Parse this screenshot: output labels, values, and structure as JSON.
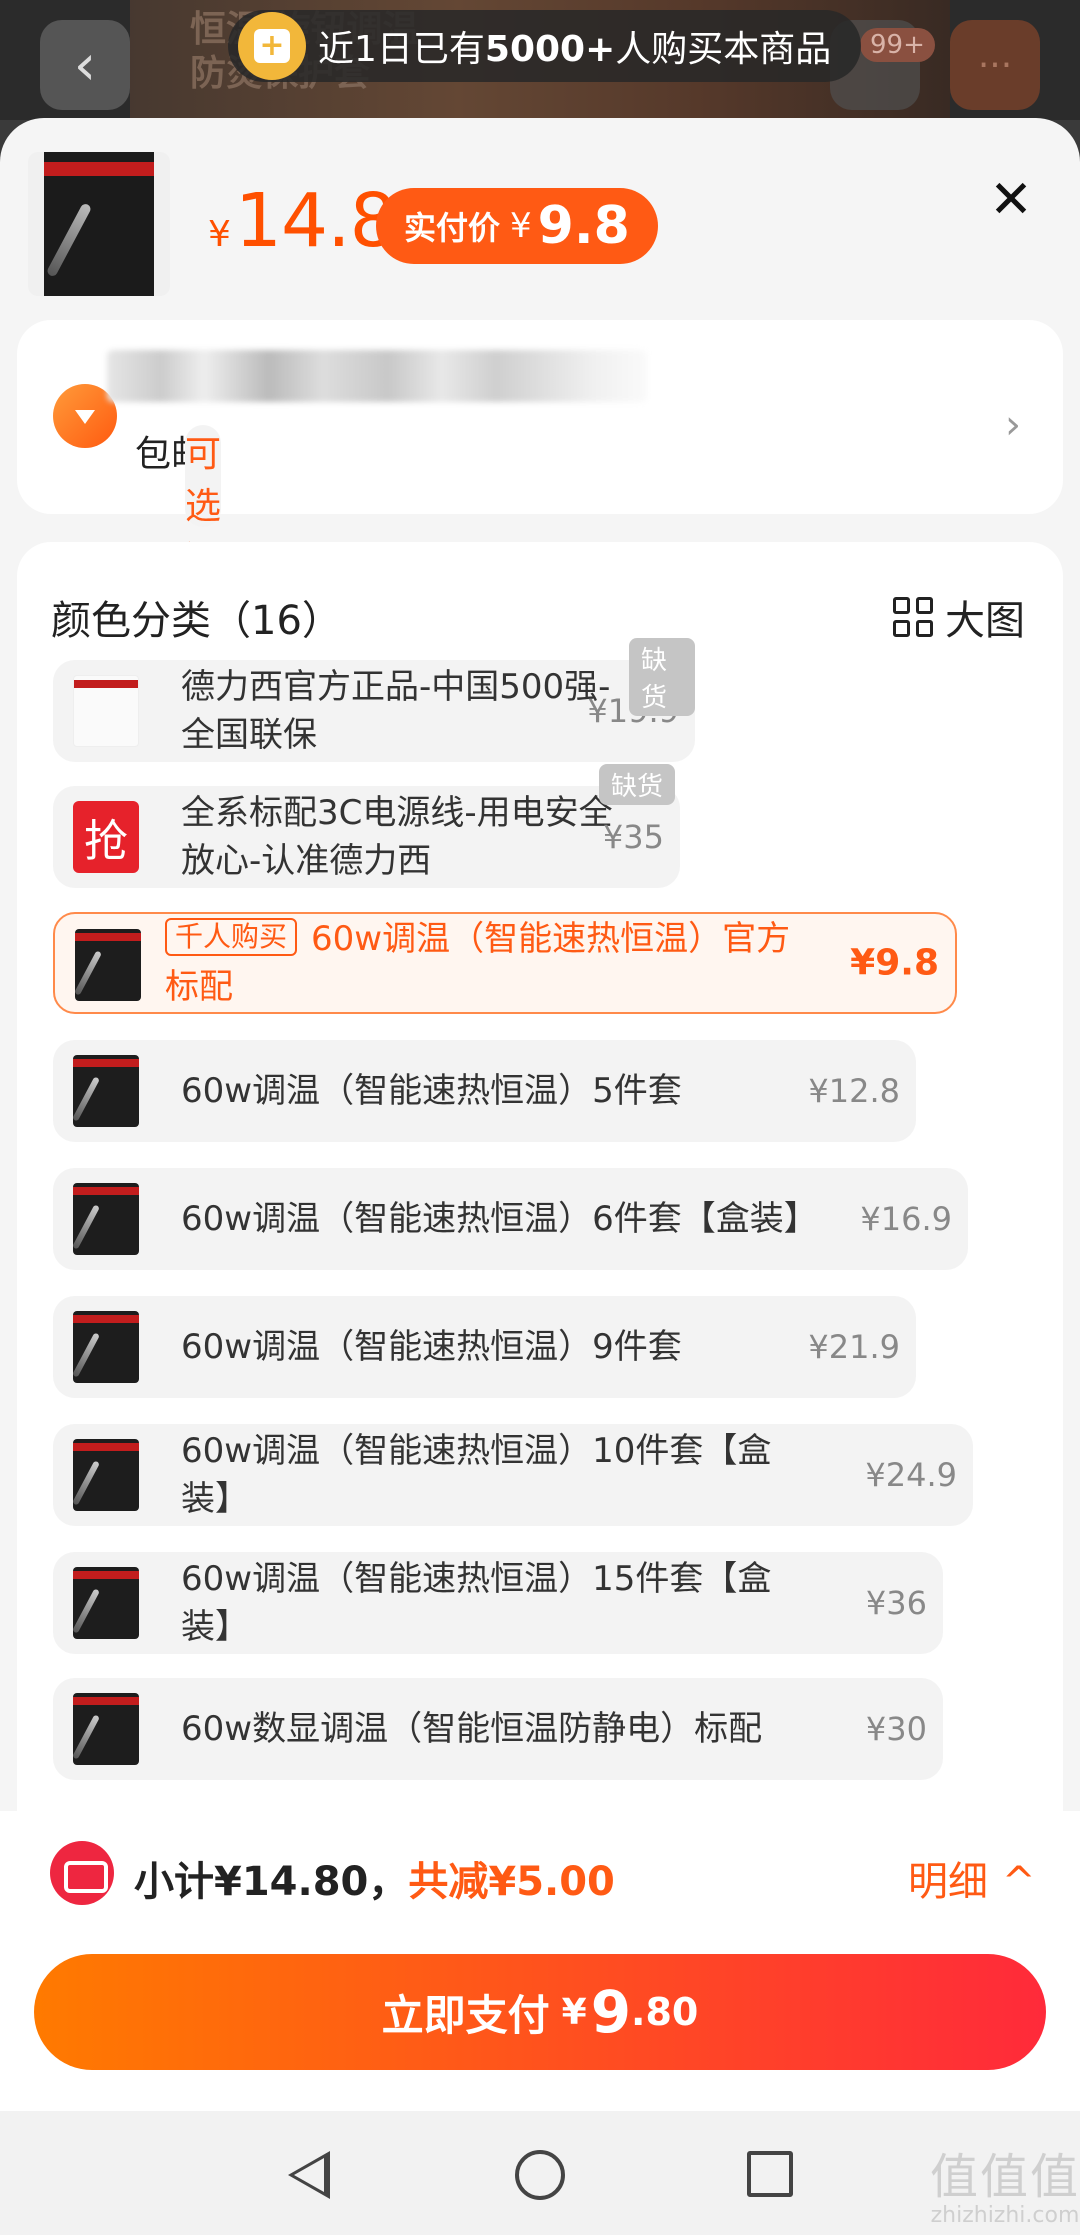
{
  "top": {
    "bg_text": "恒温 旋钮调温 防烫保护套",
    "back_icon": "‹",
    "cart_badge": "99+",
    "more_icon": "···",
    "toast": {
      "prefix": "近1日已有",
      "count": "5000+",
      "suffix": "人购买本商品"
    }
  },
  "product": {
    "price_symbol": "¥",
    "price": "14.8",
    "paid_label": "实付价",
    "paid_symbol": "¥",
    "paid_price": "9.8",
    "close_icon": "✕"
  },
  "address": {
    "shipping": "包邮",
    "insurance": "可选运费险",
    "chevron": "›"
  },
  "options": {
    "title": "颜色分类（16）",
    "big_view_label": "大图",
    "out_of_stock_label": "缺货",
    "hot_tag": "千人购买",
    "items": [
      {
        "label": "德力西官方正品-中国500强-全国联保",
        "price": "¥19.9",
        "out_of_stock": true
      },
      {
        "label": "全系标配3C电源线-用电安全放心-认准德力西",
        "price": "¥35",
        "out_of_stock": true,
        "thumb_text": "抢"
      },
      {
        "label": "60w调温（智能速热恒温）官方标配",
        "price": "¥9.8",
        "selected": true
      },
      {
        "label": "60w调温（智能速热恒温）5件套",
        "price": "¥12.8"
      },
      {
        "label": "60w调温（智能速热恒温）6件套【盒装】",
        "price": "¥16.9"
      },
      {
        "label": "60w调温（智能速热恒温）9件套",
        "price": "¥21.9"
      },
      {
        "label": "60w调温（智能速热恒温）10件套【盒装】",
        "price": "¥24.9"
      },
      {
        "label": "60w调温（智能速热恒温）15件套【盒装】",
        "price": "¥36"
      },
      {
        "label": "60w数显调温（智能恒温防静电）标配",
        "price": "¥30"
      }
    ]
  },
  "bottom": {
    "subtotal": "小计¥14.80，",
    "discount": "共减¥5.00",
    "detail": "明细",
    "detail_caret": "^",
    "pay_label": "立即支付",
    "pay_symbol": "¥",
    "pay_int": "9",
    "pay_dec": ".80"
  },
  "watermark": {
    "big": "值值值",
    "small": "zhizhizhi.com"
  }
}
